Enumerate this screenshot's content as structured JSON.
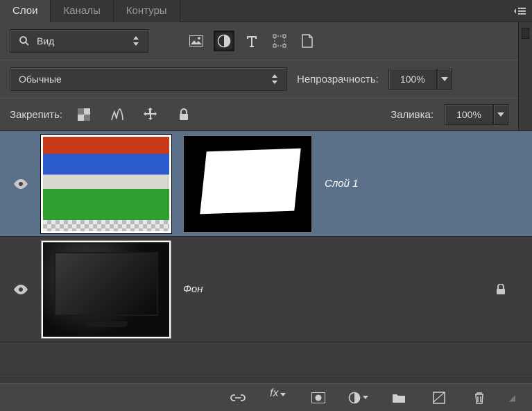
{
  "tabs": {
    "layers": "Слои",
    "channels": "Каналы",
    "paths": "Контуры"
  },
  "filter": {
    "kind": "Вид"
  },
  "blend": {
    "mode": "Обычные"
  },
  "opacity": {
    "label": "Непрозрачность:",
    "value": "100%"
  },
  "fill": {
    "label": "Заливка:",
    "value": "100%"
  },
  "lock": {
    "label": "Закрепить:"
  },
  "layers": [
    {
      "name": "Слой 1",
      "visible": true,
      "selected": true,
      "hasMask": true,
      "locked": false,
      "thumb": "sports"
    },
    {
      "name": "Фон",
      "visible": true,
      "selected": false,
      "hasMask": false,
      "locked": true,
      "thumb": "tv"
    }
  ],
  "icons": {
    "filter_pixel": "pixel-layers-icon",
    "filter_adjust": "adjustment-layers-icon",
    "filter_type": "type-layers-icon",
    "filter_shape": "shape-layers-icon",
    "filter_smart": "smart-object-icon"
  }
}
